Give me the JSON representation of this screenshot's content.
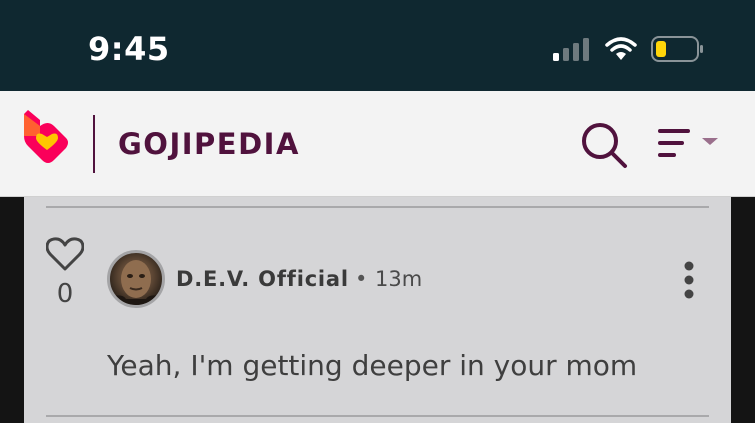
{
  "status_bar": {
    "time": "9:45",
    "icons": [
      "signal-icon",
      "wifi-icon",
      "battery-icon"
    ]
  },
  "header": {
    "wiki_name": "GOJIPEDIA",
    "brand_color": "#50123d",
    "logo_colors": [
      "#fa005a",
      "#ff6b2b",
      "#ffc500"
    ]
  },
  "comment": {
    "like_count": "0",
    "author": "D.E.V. Official",
    "separator": "•",
    "timestamp": "13m",
    "text": "Yeah, I'm getting deeper in your mom"
  }
}
